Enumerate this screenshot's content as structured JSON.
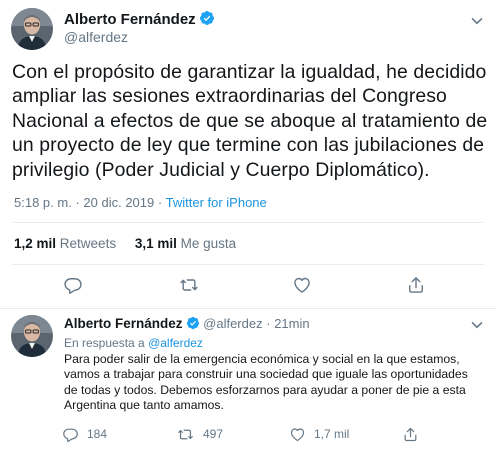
{
  "main_tweet": {
    "author_name": "Alberto Fernández",
    "handle": "@alferdez",
    "text": "Con el propósito de garantizar la igualdad, he decidido ampliar las sesiones extraordinarias del Congreso Nacional a efectos de que se aboque al tratamiento de un proyecto de ley que termine con las jubilaciones de privilegio (Poder Judicial y Cuerpo Diplomático).",
    "time": "5:18 p. m.",
    "separator": "·",
    "date": "20 dic. 2019",
    "source": "Twitter for iPhone",
    "retweets_count": "1,2 mil",
    "retweets_label": "Retweets",
    "likes_count": "3,1 mil",
    "likes_label": "Me gusta"
  },
  "reply_tweet": {
    "author_name": "Alberto Fernández",
    "handle": "@alferdez",
    "separator": "·",
    "age": "21min",
    "in_reply_prefix": "En respuesta a",
    "in_reply_mention": "@alferdez",
    "text": "Para poder salir de la emergencia económica y social en la que estamos, vamos a trabajar para construir una sociedad que iguale las oportunidades de todas y todos. Debemos esforzarnos para ayudar a poner de pie a esta Argentina que tanto amamos.",
    "reply_count": "184",
    "retweet_count": "497",
    "like_count": "1,7 mil"
  },
  "icons": {
    "verified": "verified-badge-icon",
    "more": "chevron-down-icon",
    "reply": "reply-icon",
    "retweet": "retweet-icon",
    "like": "heart-icon",
    "share": "share-icon"
  },
  "colors": {
    "text": "#14171a",
    "secondary": "#657786",
    "link": "#1b95e0",
    "verified": "#1da1f2",
    "border": "#e6ecf0"
  }
}
